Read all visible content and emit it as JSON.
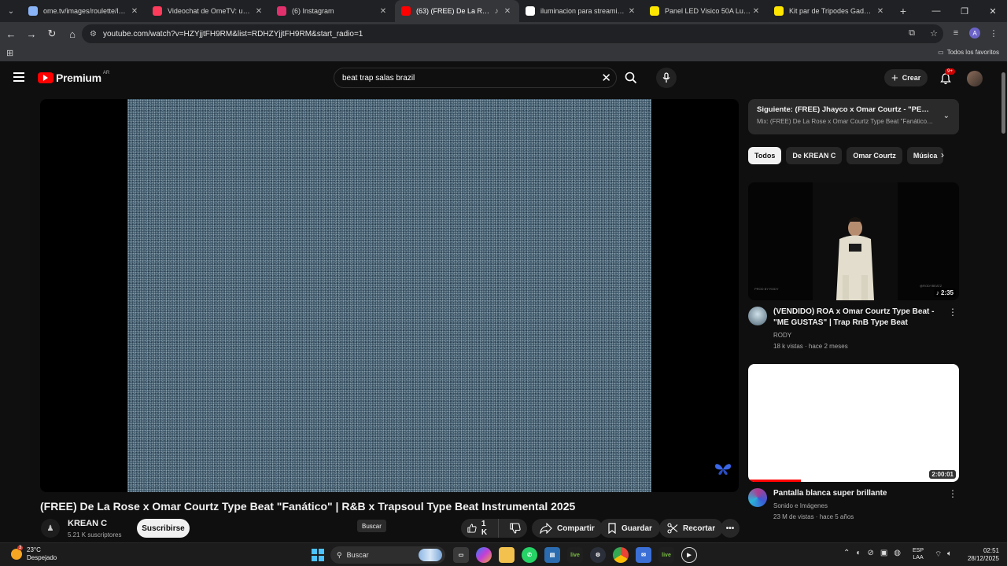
{
  "browser": {
    "tabs": [
      {
        "title": "ome.tv/images/roulette/logo_v",
        "favicon_color": "#8ab4f8"
      },
      {
        "title": "Videochat de OmeTV: una alter",
        "favicon_color": "#ff3b5c"
      },
      {
        "title": "(6) Instagram",
        "favicon_color": "#e1306c"
      },
      {
        "title": "(63) (FREE) De La Rose x Om",
        "favicon_color": "#ff0000"
      },
      {
        "title": "iluminacion para streaming - B",
        "favicon_color": "#ffffff"
      },
      {
        "title": "Panel LED Visico 50A Luz Cálid",
        "favicon_color": "#ffe600"
      },
      {
        "title": "Kit par de Tripodes Gadnic Sof",
        "favicon_color": "#ffe600"
      }
    ],
    "url": "youtube.com/watch?v=HZYjjtFH9RM&list=RDHZYjjtFH9RM&start_radio=1",
    "bookmarks_all": "Todos los favoritos",
    "profile_initial": "A"
  },
  "youtube": {
    "brand": "Premium",
    "country_code": "AR",
    "search_query": "beat trap salas brazil",
    "create_label": "Crear",
    "notif_count": "9+"
  },
  "video": {
    "title": "(FREE) De La Rose x Omar Courtz Type Beat \"Fanático\" | R&B x Trapsoul Type Beat Instrumental 2025",
    "channel": "KREAN C",
    "subscribers": "5.21 K suscriptores",
    "subscribe_label": "Suscribirse",
    "likes": "1 K",
    "share_label": "Compartir",
    "save_label": "Guardar",
    "clip_label": "Recortar",
    "tooltip": "Buscar"
  },
  "sidebar": {
    "next_title": "Siguiente: (FREE) Jhayco x Omar Courtz - \"PENDIE...",
    "next_subtitle": "Mix: (FREE) De La Rose x Omar Courtz Type Beat \"Fanático\" |...",
    "chips": [
      "Todos",
      "De KREAN C",
      "Omar Courtz",
      "Música"
    ],
    "recommendations": [
      {
        "title": "(VENDIDO) ROA x Omar Courtz Type Beat - \"ME GUSTAS\" | Trap RnB Type Beat",
        "channel": "RODY",
        "meta": "18 k vistas · hace 2 meses",
        "duration": "2:35",
        "thumb_credit_left": "PROD BY RODY",
        "thumb_credit_right": "@RODYBEATZ"
      },
      {
        "title": "Pantalla blanca super brillante",
        "channel": "Sonido e Imágenes",
        "meta": "23 M de vistas · hace 5 años",
        "duration": "2:00:01",
        "watched_fraction": 0.25
      }
    ]
  },
  "taskbar": {
    "temperature": "23°C",
    "weather": "Despejado",
    "weather_badge": "3",
    "search_placeholder": "Buscar",
    "lang_line1": "ESP",
    "lang_line2": "LAA",
    "time": "02:51",
    "date": "28/12/2025"
  }
}
